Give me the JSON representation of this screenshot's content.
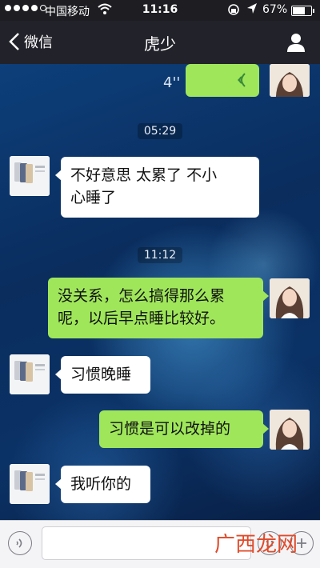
{
  "status_bar": {
    "carrier": "中国移动",
    "time": "11:16",
    "battery": "67%"
  },
  "nav": {
    "back_label": "微信",
    "title": "虎少"
  },
  "messages": {
    "voice_duration": "4''",
    "ts1": "05:29",
    "m1": [
      "不好意思 太累了 不小",
      "心睡了"
    ],
    "ts2": "11:12",
    "m2": [
      "没关系，怎么搞得那么累",
      "呢，以后早点睡比较好。"
    ],
    "m3": "习惯晚睡",
    "m4": "习惯是可以改掉的",
    "m5": "我听你的"
  },
  "watermark": "广西龙网",
  "icons": {
    "back": "chevron-left-icon",
    "profile": "person-icon",
    "voice_wave": "voice-wave-icon",
    "voice_input": "voice-input-icon",
    "emoji": "emoji-icon",
    "add": "plus-icon"
  },
  "colors": {
    "self_bubble": "#9fe65a",
    "other_bubble": "#ffffff",
    "nav_bg": "#22222a"
  }
}
